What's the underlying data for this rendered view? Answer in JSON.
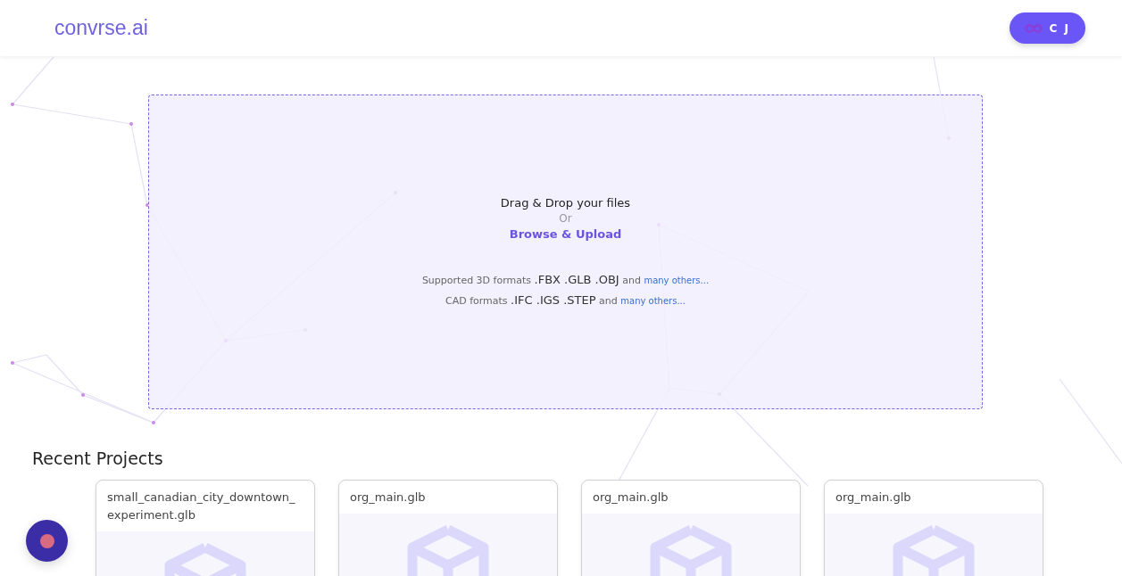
{
  "header": {
    "logo": "convrse.ai",
    "user_button": {
      "initials": "C J"
    }
  },
  "dropzone": {
    "title": "Drag & Drop your files",
    "separator": "Or",
    "action": "Browse & Upload",
    "format_lines": [
      {
        "label": "Supported 3D formats",
        "formats": ".FBX .GLB .OBJ",
        "joiner": "and",
        "link": "many others..."
      },
      {
        "label": "CAD formats",
        "formats": ".IFC .IGS .STEP",
        "joiner": "and",
        "link": "many others..."
      }
    ]
  },
  "recent_projects": {
    "heading": "Recent Projects",
    "projects": [
      {
        "name": "small_canadian_city_downtown_ experiment.glb"
      },
      {
        "name": "org_main.glb"
      },
      {
        "name": "org_main.glb"
      },
      {
        "name": "org_main.glb"
      }
    ]
  }
}
